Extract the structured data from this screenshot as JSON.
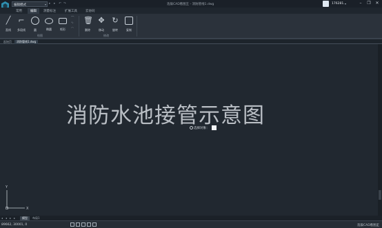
{
  "titlebar": {
    "mode_select": "编辑模式",
    "app_title": "浩辰CAD看图王 - 消防管线1.dwg",
    "user_name": "176281...",
    "quick_access_icons": [
      "open-icon",
      "save-icon",
      "undo-icon",
      "redo-icon"
    ]
  },
  "ribbon_tabs": [
    {
      "label": "常用",
      "active": false
    },
    {
      "label": "编辑",
      "active": true
    },
    {
      "label": "测量标注",
      "active": false
    },
    {
      "label": "扩展工具",
      "active": false
    },
    {
      "label": "云协同",
      "active": false
    }
  ],
  "ribbon": {
    "draw_tools": [
      {
        "label": "直线",
        "icon": "line-icon"
      },
      {
        "label": "多段线",
        "icon": "polyline-icon"
      },
      {
        "label": "圆",
        "icon": "circle-icon"
      },
      {
        "label": "椭圆",
        "icon": "ellipse-icon"
      },
      {
        "label": "矩形",
        "icon": "rectangle-icon"
      }
    ],
    "modify_tools": [
      {
        "label": "删除",
        "icon": "delete-icon"
      },
      {
        "label": "移动",
        "icon": "move-icon"
      },
      {
        "label": "旋转",
        "icon": "rotate-icon"
      },
      {
        "label": "复制",
        "icon": "copy-icon"
      }
    ],
    "groups": {
      "draw": "绘图",
      "modify": "修改"
    }
  },
  "doc_tabs": [
    {
      "label": "起始页",
      "active": false
    },
    {
      "label": "消防管线1.dwg",
      "active": true
    }
  ],
  "canvas": {
    "drawing_text": "消防水池接管示意图",
    "select_prompt": "选择对象：",
    "ucs_x": "X",
    "ucs_y": "Y"
  },
  "layout_tabs": [
    {
      "label": "模型",
      "active": true
    },
    {
      "label": "布局1",
      "active": false
    }
  ],
  "statusbar": {
    "coords": "89662, 30001, 0",
    "right_label": "浩辰CAD看图王"
  },
  "colors": {
    "canvas_bg": "#212830",
    "ribbon_bg": "#2b323b",
    "text": "#c9d0d8"
  }
}
